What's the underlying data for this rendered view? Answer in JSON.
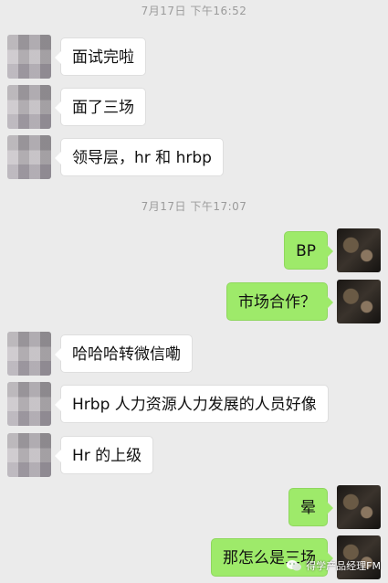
{
  "timestamps": [
    "7月17日 下午16:52",
    "7月17日 下午17:07"
  ],
  "messages": [
    {
      "side": "left",
      "text": "面试完啦"
    },
    {
      "side": "left",
      "text": "面了三场"
    },
    {
      "side": "left",
      "text": "领导层，hr 和 hrbp"
    },
    {
      "side": "right",
      "text": "BP"
    },
    {
      "side": "right",
      "text": "市场合作？"
    },
    {
      "side": "left",
      "text": "哈哈哈转微信嘞"
    },
    {
      "side": "left",
      "text": "Hrbp 人力资源人力发展的人员好像"
    },
    {
      "side": "left",
      "text": "Hr 的上级"
    },
    {
      "side": "right",
      "text": "晕"
    },
    {
      "side": "right",
      "text": "那怎么是三场"
    }
  ],
  "watermark": {
    "text": "得学产品经理FM",
    "icon": "wechat-icon"
  },
  "colors": {
    "background": "#ebebeb",
    "incoming_bubble": "#ffffff",
    "outgoing_bubble": "#9eea6a"
  }
}
